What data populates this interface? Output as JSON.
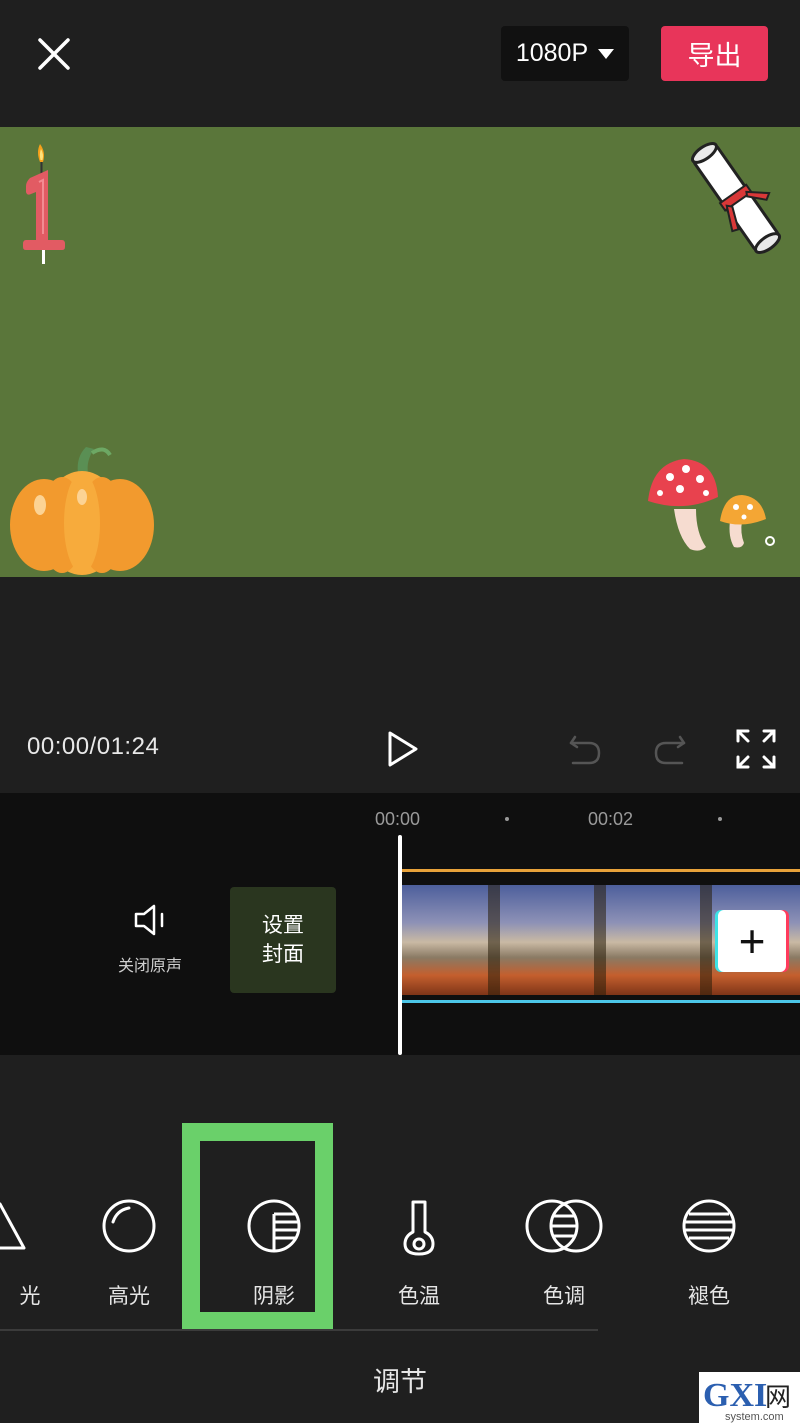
{
  "top_bar": {
    "close_icon": "close-icon",
    "resolution_label": "1080P",
    "resolution_icon": "caret-down-icon",
    "export_label": "导出"
  },
  "preview": {
    "background_color": "#5a763a",
    "stickers": [
      "birthday-candle-number-one-icon",
      "scroll-diploma-icon",
      "pumpkin-icon",
      "mushroom-icon"
    ]
  },
  "playback": {
    "timecode": "00:00/01:24",
    "play_icon": "play-icon",
    "undo_icon": "undo-icon",
    "redo_icon": "redo-icon",
    "fullscreen_icon": "fullscreen-icon"
  },
  "timeline": {
    "ruler": [
      "00:00",
      "00:02"
    ],
    "mute_label": "关闭原声",
    "cover_line1": "设置",
    "cover_line2": "封面",
    "add_clip_label": "+"
  },
  "tools": [
    {
      "label": "光",
      "icon": "triangle-icon"
    },
    {
      "label": "高光",
      "icon": "highlight-circle-icon"
    },
    {
      "label": "阴影",
      "icon": "shadow-circle-icon"
    },
    {
      "label": "色温",
      "icon": "thermometer-icon"
    },
    {
      "label": "色调",
      "icon": "overlapping-circles-icon"
    },
    {
      "label": "褪色",
      "icon": "fade-striped-circle-icon"
    }
  ],
  "selected_tool": "阴影",
  "panel_title": "调节",
  "colors": {
    "background": "#1f1f1f",
    "accent_export": "#e8355a",
    "selection_highlight": "#6ad06a",
    "timeline_bg": "#0f0f0f"
  },
  "watermark": {
    "main": "GXI网",
    "sub": "system.com"
  }
}
